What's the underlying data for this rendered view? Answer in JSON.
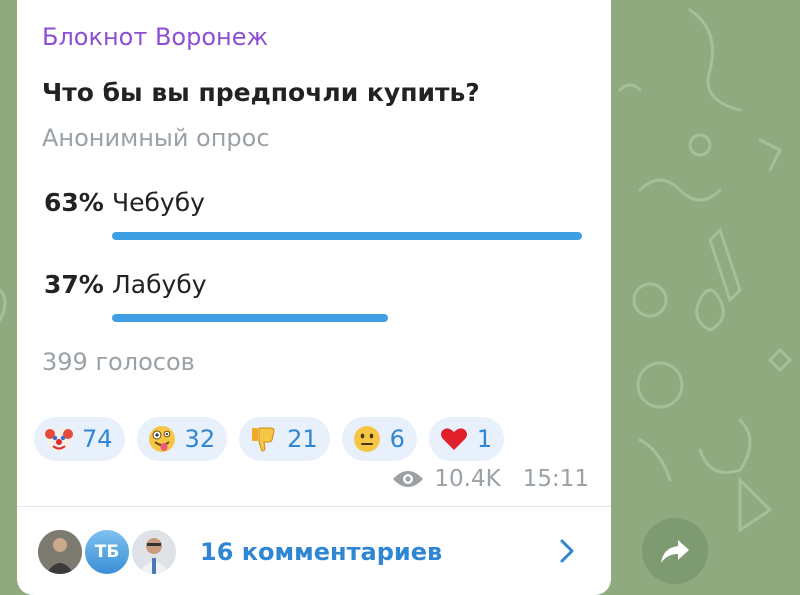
{
  "post": {
    "channel_name": "Блокнот Воронеж",
    "question": "Что бы вы предпочли купить?",
    "poll_type": "Анонимный опрос",
    "options": [
      {
        "percent_label": "63%",
        "label": "Чебубу",
        "fraction": 0.63
      },
      {
        "percent_label": "37%",
        "label": "Лабубу",
        "fraction": 0.37
      }
    ],
    "votes": "399 голосов",
    "reactions": [
      {
        "emoji": "clown-face",
        "count": "74"
      },
      {
        "emoji": "zany-face",
        "count": "32"
      },
      {
        "emoji": "thumbs-down",
        "count": "21"
      },
      {
        "emoji": "neutral-face",
        "count": "6"
      },
      {
        "emoji": "red-heart",
        "count": "1"
      }
    ],
    "views": "10.4K",
    "time": "15:11"
  },
  "comments": {
    "avatar_initials": "ТБ",
    "label": "16 комментариев"
  },
  "colors": {
    "accent": "#3e9fe2",
    "channel": "#8c4fd6",
    "background": "#8faa7f"
  }
}
